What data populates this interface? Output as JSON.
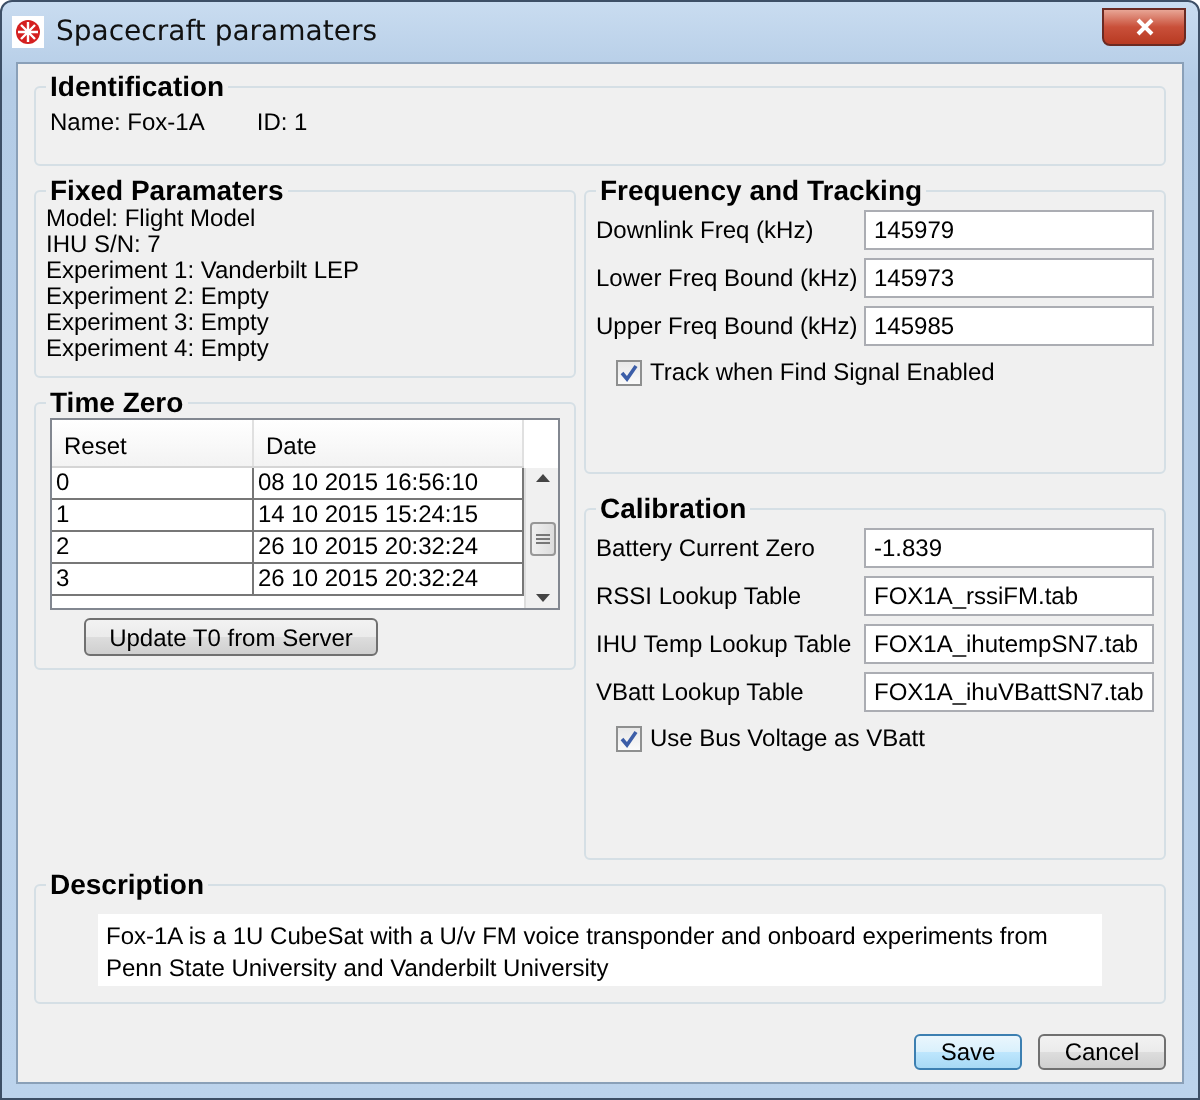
{
  "window": {
    "title": "Spacecraft paramaters"
  },
  "identification": {
    "title": "Identification",
    "name": "Name: Fox-1A",
    "id": "ID: 1"
  },
  "fixed_parameters": {
    "title": "Fixed Paramaters",
    "lines": [
      "Model: Flight Model",
      "IHU S/N: 7",
      "Experiment 1: Vanderbilt LEP",
      "Experiment 2: Empty",
      "Experiment 3: Empty",
      "Experiment 4: Empty"
    ]
  },
  "time_zero": {
    "title": "Time Zero",
    "columns": [
      "Reset",
      "Date"
    ],
    "rows": [
      [
        "0",
        "08 10 2015 16:56:10"
      ],
      [
        "1",
        "14 10 2015 15:24:15"
      ],
      [
        "2",
        "26 10 2015 20:32:24"
      ],
      [
        "3",
        "26 10 2015 20:32:24"
      ]
    ],
    "button": "Update T0 from Server"
  },
  "frequency": {
    "title": "Frequency and Tracking",
    "fields": [
      {
        "label": "Downlink Freq (kHz)",
        "value": "145979"
      },
      {
        "label": "Lower Freq Bound (kHz)",
        "value": "145973"
      },
      {
        "label": "Upper Freq Bound (kHz)",
        "value": "145985"
      }
    ],
    "checkbox": {
      "label": "Track when Find Signal Enabled",
      "checked": true
    }
  },
  "calibration": {
    "title": "Calibration",
    "fields": [
      {
        "label": "Battery Current Zero",
        "value": "-1.839"
      },
      {
        "label": "RSSI Lookup Table",
        "value": "FOX1A_rssiFM.tab"
      },
      {
        "label": "IHU Temp Lookup Table",
        "value": "FOX1A_ihutempSN7.tab"
      },
      {
        "label": "VBatt Lookup Table",
        "value": "FOX1A_ihuVBattSN7.tab"
      }
    ],
    "checkbox": {
      "label": "Use Bus Voltage as VBatt",
      "checked": true
    }
  },
  "description": {
    "title": "Description",
    "text": "Fox-1A is a 1U CubeSat with a U/v FM voice transponder and onboard experiments from Penn State University and Vanderbilt University"
  },
  "buttons": [
    {
      "label": "Save",
      "default": true
    },
    {
      "label": "Cancel",
      "default": false
    }
  ]
}
